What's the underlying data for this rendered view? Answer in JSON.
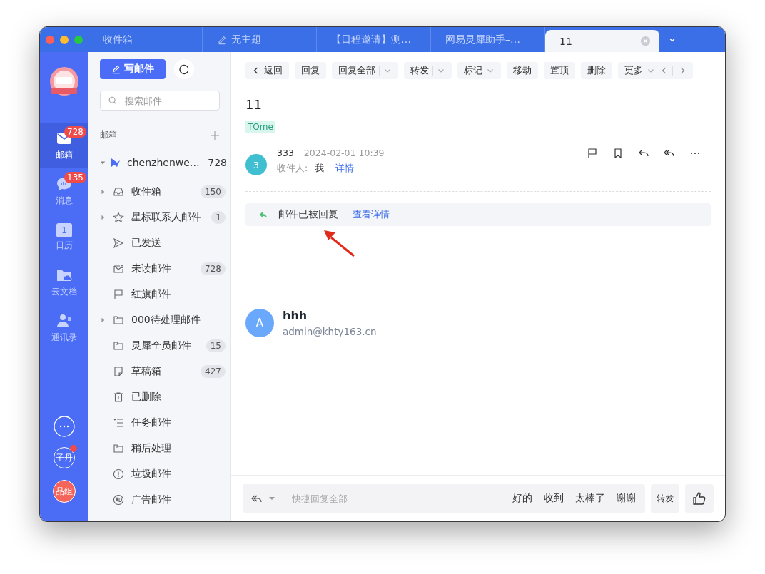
{
  "tabs": [
    {
      "label": "收件箱",
      "selected": false,
      "kind": "plain"
    },
    {
      "label": "无主题",
      "selected": false,
      "kind": "draft"
    },
    {
      "label": "【日程邀请】测…",
      "selected": false,
      "kind": "plain"
    },
    {
      "label": "网易灵犀助手–…",
      "selected": false,
      "kind": "plain"
    },
    {
      "label": "11",
      "selected": true,
      "kind": "plain"
    }
  ],
  "rail": {
    "items": [
      {
        "label": "邮箱",
        "kind": "mail",
        "badge": "728",
        "selected": true
      },
      {
        "label": "消息",
        "kind": "chat",
        "badge": "135",
        "selected": false
      },
      {
        "label": "日历",
        "kind": "calendar",
        "day": "1",
        "selected": false
      },
      {
        "label": "云文档",
        "kind": "docs",
        "selected": false
      },
      {
        "label": "通讯录",
        "kind": "contacts",
        "selected": false
      }
    ],
    "avatars": [
      {
        "label": "子丹",
        "kind": "person",
        "notify": true
      },
      {
        "label": "品组",
        "kind": "group",
        "notify": false
      }
    ]
  },
  "folders": {
    "compose": "写邮件",
    "search_placeholder": "搜索邮件",
    "section": "邮箱",
    "account": {
      "name": "chenzhenwe…",
      "count": "728",
      "expanded": true
    },
    "items": [
      {
        "label": "收件箱",
        "kind": "inbox",
        "count": "150",
        "expandable": true
      },
      {
        "label": "星标联系人邮件",
        "kind": "star",
        "count": "1",
        "expandable": true
      },
      {
        "label": "已发送",
        "kind": "sent",
        "expandable": false
      },
      {
        "label": "未读邮件",
        "kind": "unread",
        "count": "728",
        "expandable": false
      },
      {
        "label": "红旗邮件",
        "kind": "flag",
        "expandable": false
      },
      {
        "label": "000待处理邮件",
        "kind": "folder",
        "expandable": true
      },
      {
        "label": "灵犀全员邮件",
        "kind": "folder",
        "count": "15",
        "expandable": false
      },
      {
        "label": "草稿箱",
        "kind": "draft",
        "count": "427",
        "expandable": false
      },
      {
        "label": "已删除",
        "kind": "trash",
        "expandable": false
      },
      {
        "label": "任务邮件",
        "kind": "task",
        "expandable": false
      },
      {
        "label": "稍后处理",
        "kind": "folder",
        "expandable": false
      },
      {
        "label": "垃圾邮件",
        "kind": "spam",
        "expandable": false
      },
      {
        "label": "广告邮件",
        "kind": "ad",
        "expandable": false
      }
    ]
  },
  "toolbar": [
    {
      "label": "返回",
      "kind": "back"
    },
    {
      "label": "回复",
      "kind": "plain"
    },
    {
      "label": "回复全部",
      "kind": "split"
    },
    {
      "label": "转发",
      "kind": "split"
    },
    {
      "label": "标记",
      "kind": "menu"
    },
    {
      "label": "移动",
      "kind": "plain"
    },
    {
      "label": "置顶",
      "kind": "plain"
    },
    {
      "label": "删除",
      "kind": "plain"
    },
    {
      "label": "更多",
      "kind": "more"
    }
  ],
  "message": {
    "subject": "11",
    "tag": "TOme",
    "sender": {
      "avatar": "3",
      "name": "333",
      "date": "2024-02-01 10:39",
      "to_label": "收件人:",
      "to": "我",
      "details": "详情"
    },
    "notice": {
      "text": "邮件已被回复",
      "link": "查看详情"
    },
    "signature": {
      "avatar": "A",
      "name": "hhh",
      "email": "admin@khty163.cn"
    }
  },
  "quick_reply": {
    "placeholder": "快捷回复全部",
    "phrases": [
      "好的",
      "收到",
      "太棒了",
      "谢谢"
    ],
    "forward": "转发"
  }
}
